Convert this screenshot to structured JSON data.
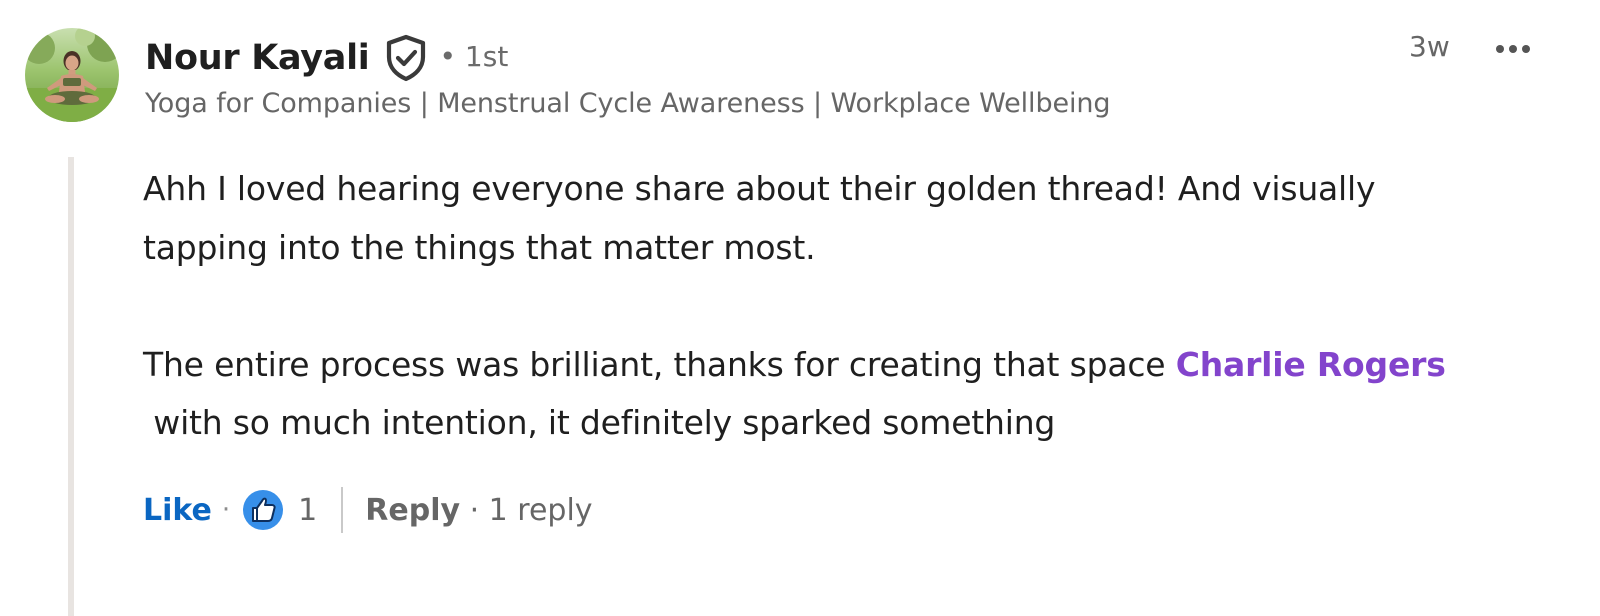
{
  "author": {
    "name": "Nour Kayali",
    "degree": "• 1st",
    "headline": "Yoga for Companies | Menstrual Cycle Awareness | Workplace Wellbeing"
  },
  "timestamp": "3w",
  "icons": {
    "more": "ellipsis-icon",
    "verified": "shield-check-icon",
    "reaction": "thumbs-up-icon"
  },
  "comment": {
    "paragraph1_line1": "Ahh I loved hearing everyone share about their golden thread! And visually",
    "paragraph1_line2": "tapping into the things that matter most.",
    "paragraph2_line1_prefix": "The entire process was brilliant, thanks for creating that space ",
    "mention": "Charlie Rogers",
    "paragraph2_line2": "with so much intention, it definitely sparked something"
  },
  "actions": {
    "like_label": "Like",
    "dot": "·",
    "reaction_count": "1",
    "reply_label": "Reply",
    "reply_count": "· 1 reply"
  },
  "colors": {
    "like_blue": "#0a66c2",
    "mention_purple": "#8344cc",
    "reaction_blue": "#378fe9"
  }
}
